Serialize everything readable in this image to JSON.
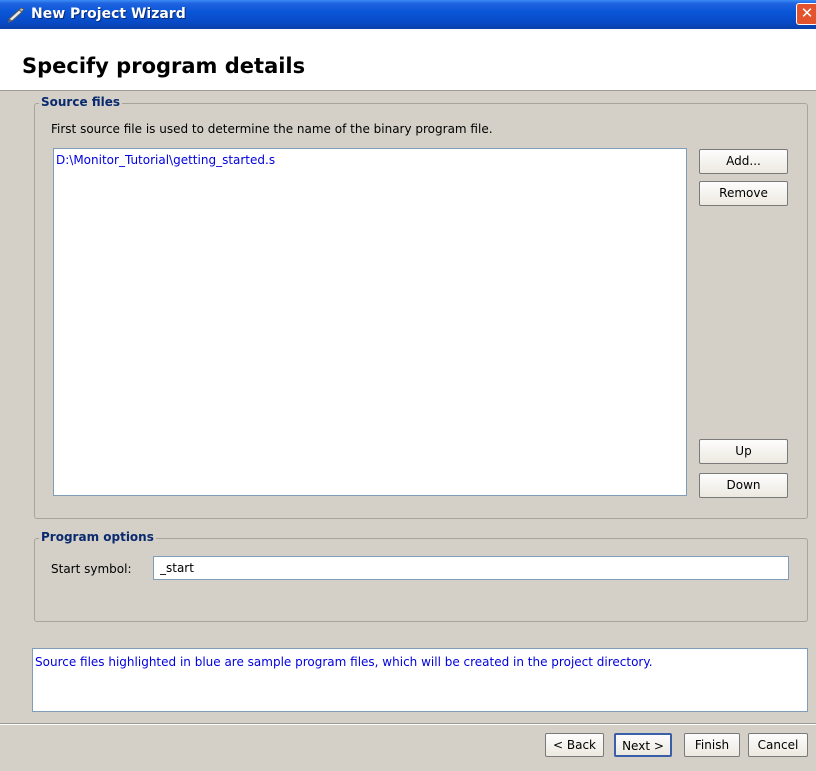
{
  "window": {
    "title": "New Project Wizard",
    "close_label": "✕"
  },
  "header": {
    "title": "Specify program details"
  },
  "source_files": {
    "legend": "Source files",
    "description": "First source file is used to determine the name of the binary program file.",
    "files": [
      "D:\\Monitor_Tutorial\\getting_started.s"
    ],
    "file_color": "#0000e0",
    "buttons": {
      "add": "Add...",
      "remove": "Remove",
      "up": "Up",
      "down": "Down"
    }
  },
  "program_options": {
    "legend": "Program options",
    "start_symbol_label": "Start symbol:",
    "start_symbol_value": "_start"
  },
  "message": "Source files highlighted in blue are sample program files, which will be created in the project directory.",
  "nav": {
    "back": "< Back",
    "next": "Next >",
    "finish": "Finish",
    "cancel": "Cancel"
  },
  "colors": {
    "titlebar": "#0a56d8",
    "highlight_text": "#0000e0",
    "close_button": "#e5532d"
  }
}
